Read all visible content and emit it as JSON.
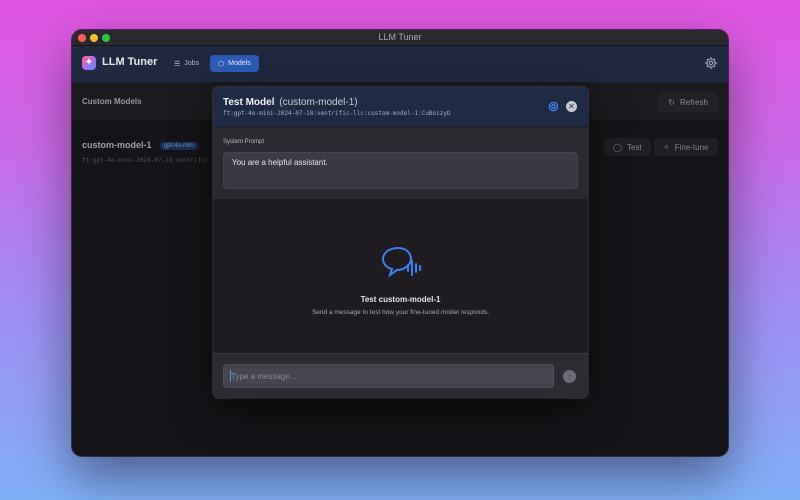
{
  "window": {
    "title": "LLM Tuner"
  },
  "app": {
    "name": "LLM Tuner",
    "nav": [
      {
        "label": "Jobs",
        "icon": "list-icon"
      },
      {
        "label": "Models",
        "icon": "cube-icon",
        "active": true
      }
    ]
  },
  "page": {
    "section_title": "Custom Models",
    "refresh_label": "Refresh"
  },
  "models": [
    {
      "name": "custom-model-1",
      "base": "gpt-4o-mini",
      "id": "ft:gpt-4o-mini-2024-07-18:ventrific",
      "test_label": "Test",
      "finetune_label": "Fine-tune"
    }
  ],
  "modal": {
    "title": "Test Model",
    "model_name": "(custom-model-1)",
    "model_id": "ft:gpt-4o-mini-2024-07-18:ventrific-llc:custom-model-1:CuBoizyD",
    "system_prompt_label": "System Prompt",
    "system_prompt_value": "You are a helpful assistant.",
    "empty_title": "Test custom-model-1",
    "empty_desc": "Send a message to test how your fine-tuned model responds.",
    "input_placeholder": "Type a message...",
    "accent": "#3b82f6"
  }
}
